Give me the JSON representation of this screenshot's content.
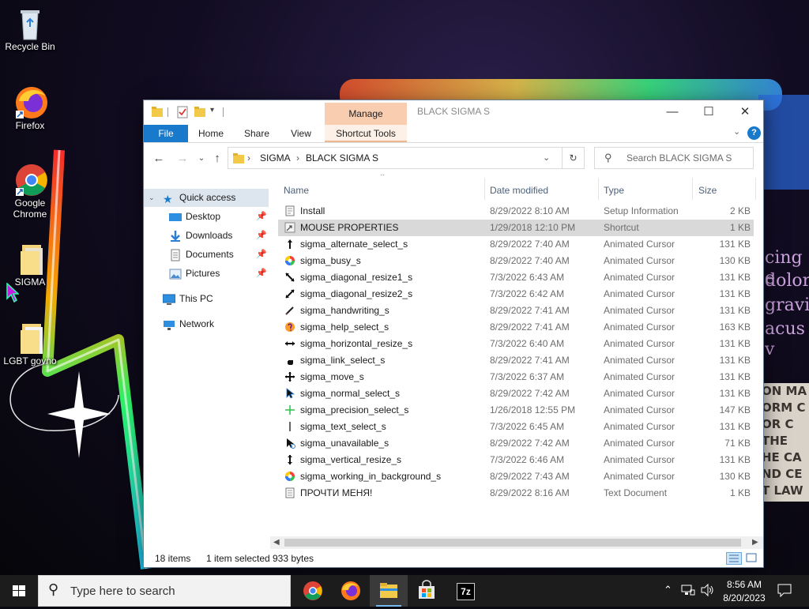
{
  "desktop": {
    "icons": [
      {
        "label": "Recycle Bin"
      },
      {
        "label": "Firefox"
      },
      {
        "label": "Google Chrome"
      },
      {
        "label": "SIGMA"
      },
      {
        "label": "LGBT govno"
      }
    ],
    "wallpaper_text": [
      "cing e",
      "dolor",
      "gravic",
      "acus v"
    ],
    "wallpaper_block": [
      "ON MA",
      "ORM C",
      "OR C",
      "THE",
      "HE CA",
      "ND CE",
      "T LAW"
    ]
  },
  "window": {
    "title": "BLACK SIGMA S",
    "manage_tab": "Manage",
    "ribbon_tabs": {
      "file": "File",
      "home": "Home",
      "share": "Share",
      "view": "View",
      "shortcut_tools": "Shortcut Tools"
    },
    "address": {
      "crumbs": [
        "SIGMA",
        "BLACK SIGMA S"
      ]
    },
    "search": {
      "placeholder": "Search BLACK SIGMA S"
    },
    "nav": {
      "quick_access": "Quick access",
      "items": [
        "Desktop",
        "Downloads",
        "Documents",
        "Pictures"
      ],
      "this_pc": "This PC",
      "network": "Network"
    },
    "columns": {
      "name": "Name",
      "date": "Date modified",
      "type": "Type",
      "size": "Size"
    },
    "files": [
      {
        "name": "Install",
        "date": "8/29/2022 8:10 AM",
        "type": "Setup Information",
        "size": "2 KB",
        "icon": "setup-info-icon"
      },
      {
        "name": "MOUSE PROPERTIES",
        "date": "1/29/2018 12:10 PM",
        "type": "Shortcut",
        "size": "1 KB",
        "icon": "shortcut-icon"
      },
      {
        "name": "sigma_alternate_select_s",
        "date": "8/29/2022 7:40 AM",
        "type": "Animated Cursor",
        "size": "131 KB",
        "icon": "cursor-up-arrow-icon"
      },
      {
        "name": "sigma_busy_s",
        "date": "8/29/2022 7:40 AM",
        "type": "Animated Cursor",
        "size": "130 KB",
        "icon": "cursor-busy-icon"
      },
      {
        "name": "sigma_diagonal_resize1_s",
        "date": "7/3/2022 6:43 AM",
        "type": "Animated Cursor",
        "size": "131 KB",
        "icon": "cursor-diagonal1-icon"
      },
      {
        "name": "sigma_diagonal_resize2_s",
        "date": "7/3/2022 6:42 AM",
        "type": "Animated Cursor",
        "size": "131 KB",
        "icon": "cursor-diagonal2-icon"
      },
      {
        "name": "sigma_handwriting_s",
        "date": "8/29/2022 7:41 AM",
        "type": "Animated Cursor",
        "size": "131 KB",
        "icon": "cursor-pen-icon"
      },
      {
        "name": "sigma_help_select_s",
        "date": "8/29/2022 7:41 AM",
        "type": "Animated Cursor",
        "size": "163 KB",
        "icon": "cursor-help-icon"
      },
      {
        "name": "sigma_horizontal_resize_s",
        "date": "7/3/2022 6:40 AM",
        "type": "Animated Cursor",
        "size": "131 KB",
        "icon": "cursor-horizontal-icon"
      },
      {
        "name": "sigma_link_select_s",
        "date": "8/29/2022 7:41 AM",
        "type": "Animated Cursor",
        "size": "131 KB",
        "icon": "cursor-hand-icon"
      },
      {
        "name": "sigma_move_s",
        "date": "7/3/2022 6:37 AM",
        "type": "Animated Cursor",
        "size": "131 KB",
        "icon": "cursor-move-icon"
      },
      {
        "name": "sigma_normal_select_s",
        "date": "8/29/2022 7:42 AM",
        "type": "Animated Cursor",
        "size": "131 KB",
        "icon": "cursor-arrow-icon"
      },
      {
        "name": "sigma_precision_select_s",
        "date": "1/26/2018 12:55 PM",
        "type": "Animated Cursor",
        "size": "147 KB",
        "icon": "cursor-crosshair-icon"
      },
      {
        "name": "sigma_text_select_s",
        "date": "7/3/2022 6:45 AM",
        "type": "Animated Cursor",
        "size": "131 KB",
        "icon": "cursor-ibeam-icon"
      },
      {
        "name": "sigma_unavailable_s",
        "date": "8/29/2022 7:42 AM",
        "type": "Animated Cursor",
        "size": "71 KB",
        "icon": "cursor-unavailable-icon"
      },
      {
        "name": "sigma_vertical_resize_s",
        "date": "7/3/2022 6:46 AM",
        "type": "Animated Cursor",
        "size": "131 KB",
        "icon": "cursor-vertical-icon"
      },
      {
        "name": "sigma_working_in_background_s",
        "date": "8/29/2022 7:43 AM",
        "type": "Animated Cursor",
        "size": "130 KB",
        "icon": "cursor-working-icon"
      },
      {
        "name": "ПРОЧТИ МЕНЯ!",
        "date": "8/29/2022 8:16 AM",
        "type": "Text Document",
        "size": "1 KB",
        "icon": "text-document-icon"
      }
    ],
    "selected_index": 1,
    "status": {
      "items": "18 items",
      "selected": "1 item selected",
      "bytes": "933 bytes"
    }
  },
  "taskbar": {
    "search_placeholder": "Type here to search",
    "time": "8:56 AM",
    "date": "8/20/2023"
  },
  "colors": {
    "accent": "#1979ca",
    "manage_tab": "#f9cdb0",
    "selection": "#d9d9d9",
    "taskbar": "#1c1c1c"
  }
}
